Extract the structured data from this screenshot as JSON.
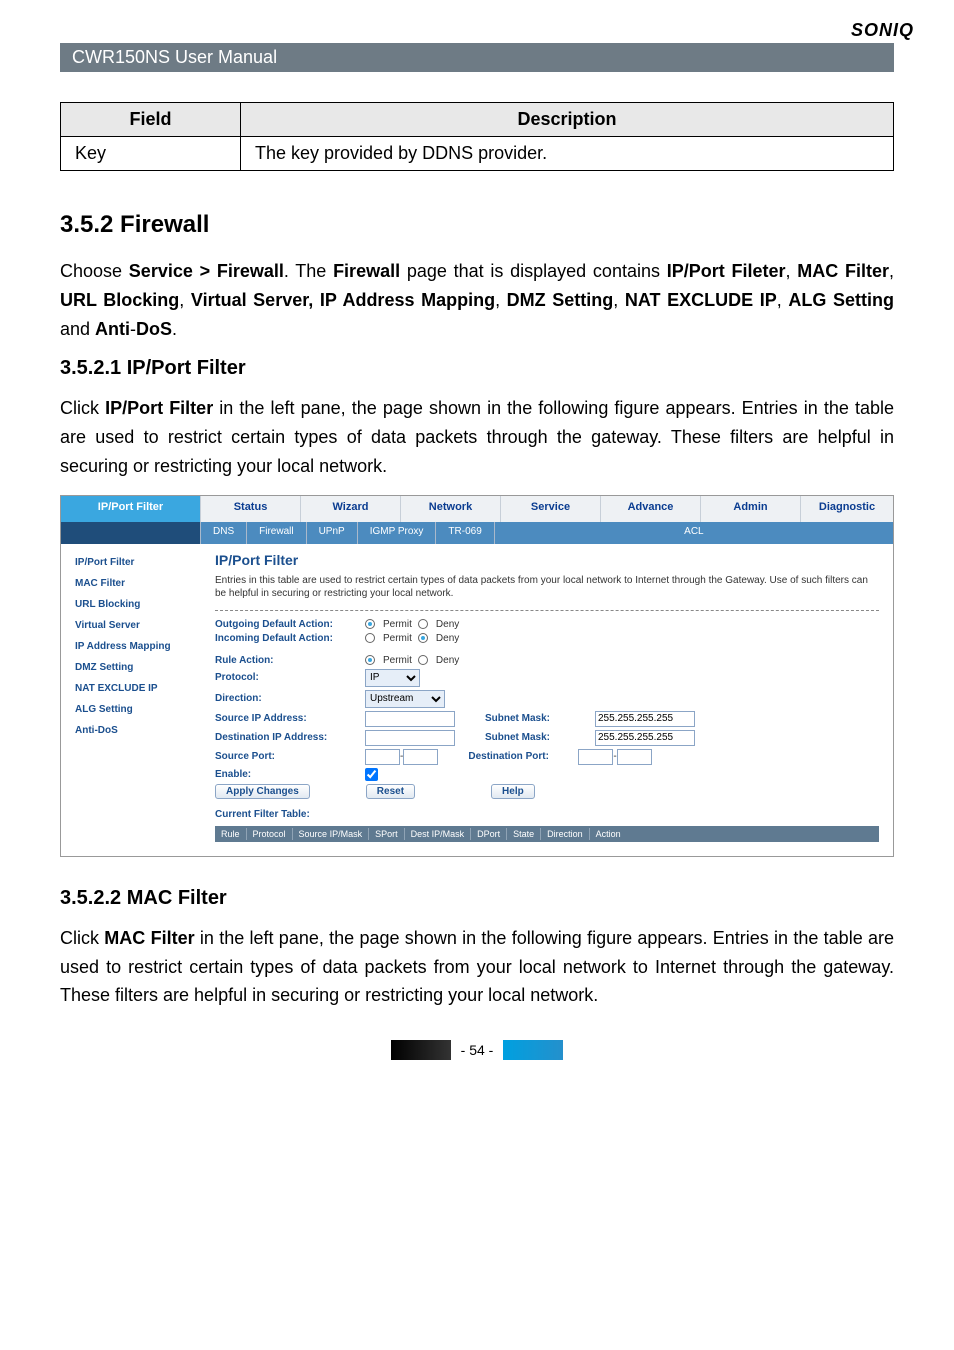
{
  "brand": "SONIQ",
  "title_bar": "CWR150NS User Manual",
  "kv_table": {
    "headers": [
      "Field",
      "Description"
    ],
    "rows": [
      {
        "field": "Key",
        "desc": "The key provided by DDNS provider."
      }
    ]
  },
  "section_352": {
    "heading": "3.5.2  Firewall",
    "para_parts": {
      "t1": "Choose ",
      "b1": "Service > Firewall",
      "t2": ". The ",
      "b2": "Firewall",
      "t3": " page that is displayed contains ",
      "b3": "IP/Port Fileter",
      "t4": ", ",
      "b4": "MAC Filter",
      "t5": ", ",
      "b5": "URL Blocking",
      "t6": ", ",
      "b6": "Virtual Server, IP Address Mapping",
      "t7": ", ",
      "b7": "DMZ Setting",
      "t8": ", ",
      "b8": "NAT EXCLUDE IP",
      "t9": ", ",
      "b9": "ALG Setting",
      "t10": " and ",
      "b10": "Anti",
      "t11": "-",
      "b11": "DoS",
      "t12": "."
    }
  },
  "sub_3521": {
    "heading": "3.5.2.1  IP/Port Filter",
    "para_parts": {
      "t1": "Click ",
      "b1": "IP/Port Filter",
      "t2": " in the left pane, the page shown in the following figure appears. Entries in the table are used to restrict certain types of data packets through the gateway. These filters are helpful in securing or restricting your local network."
    }
  },
  "screenshot": {
    "tabs_top": [
      "IP/Port Filter",
      "Status",
      "Wizard",
      "Network",
      "Service",
      "Advance",
      "Admin",
      "Diagnostic"
    ],
    "tabs_sub": [
      "DNS",
      "Firewall",
      "UPnP",
      "IGMP Proxy",
      "TR-069",
      "ACL"
    ],
    "sidemenu": [
      "IP/Port Filter",
      "MAC Filter",
      "URL Blocking",
      "Virtual Server",
      "IP Address Mapping",
      "DMZ Setting",
      "NAT EXCLUDE IP",
      "ALG Setting",
      "Anti-DoS"
    ],
    "main": {
      "title": "IP/Port Filter",
      "desc": "Entries in this table are used to restrict certain types of data packets from your local network to Internet through the Gateway. Use of such filters can be helpful in securing or restricting your local network.",
      "fields": {
        "out_label": "Outgoing Default Action:",
        "in_label": "Incoming Default Action:",
        "permit": "Permit",
        "deny": "Deny",
        "rule_action": "Rule Action:",
        "protocol": "Protocol:",
        "protocol_val": "IP",
        "direction": "Direction:",
        "direction_val": "Upstream",
        "src_ip": "Source IP Address:",
        "dst_ip": "Destination IP Address:",
        "src_port": "Source Port:",
        "enable": "Enable:",
        "subnet_mask": "Subnet Mask:",
        "subnet_val": "255.255.255.255",
        "dest_port": "Destination Port:",
        "dash": "-",
        "apply": "Apply Changes",
        "reset": "Reset",
        "help": "Help",
        "cft": "Current Filter Table:",
        "cft_cols": [
          "Rule",
          "Protocol",
          "Source IP/Mask",
          "SPort",
          "Dest IP/Mask",
          "DPort",
          "State",
          "Direction",
          "Action"
        ]
      }
    }
  },
  "sub_3522": {
    "heading": "3.5.2.2  MAC Filter",
    "para_parts": {
      "t1": "Click ",
      "b1": "MAC Filter",
      "t2": " in the left pane, the page shown in the following figure appears. Entries in the table are used to restrict certain types of data packets from your local network to Internet through the gateway. These filters are helpful in securing or restricting your local network."
    }
  },
  "page_number": "- 54 -"
}
